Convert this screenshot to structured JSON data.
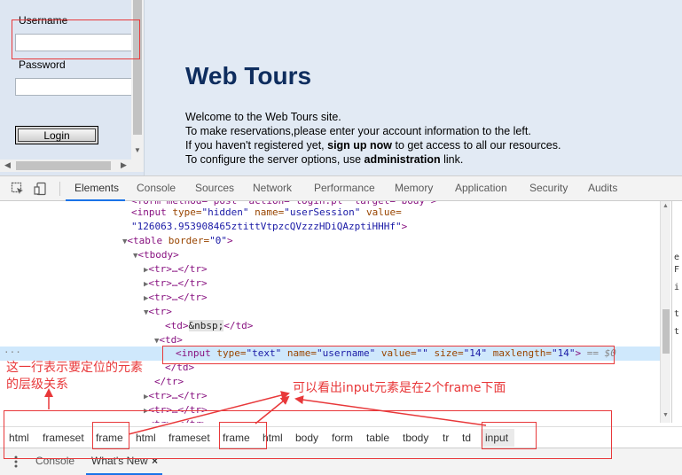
{
  "login": {
    "username_label": "Username",
    "password_label": "Password",
    "username_value": "",
    "password_value": "",
    "login_button": "Login"
  },
  "welcome": {
    "title": "Web Tours",
    "line1": "Welcome to the Web Tours site.",
    "line2": "To make reservations,please enter your account information to the left.",
    "line3_pre": "If you haven't registered yet, ",
    "line3_bold": "sign up now",
    "line3_post": " to get access to all our resources.",
    "line4_pre": "To configure the server options, use ",
    "line4_bold": "administration",
    "line4_post": " link."
  },
  "devtools": {
    "tabs": [
      "Elements",
      "Console",
      "Sources",
      "Network",
      "Performance",
      "Memory",
      "Application",
      "Security",
      "Audits"
    ],
    "active_tab": "Elements",
    "code": {
      "l0": "<form method=\"post\" action=\"login.pl\" target=\"body\">",
      "l1_tag": "<input",
      "l1_a1n": " type=",
      "l1_a1v": "\"hidden\"",
      "l1_a2n": " name=",
      "l1_a2v": "\"userSession\"",
      "l1_a3n": " value=",
      "l2_val": "\"126063.953908465ztittVtpzcQVzzzHDiQAzptiHHHf\"",
      "l2_end": ">",
      "l3_tag": "<table",
      "l3_an": " border=",
      "l3_av": "\"0\"",
      "l3_end": ">",
      "l4": "<tbody>",
      "tr_collapsed": "<tr>…</tr>",
      "tr_open": "<tr>",
      "td_open": "<td>",
      "td_close": "</td>",
      "nbsp": "&nbsp;",
      "sel_tag": "<input",
      "sel_a1n": " type=",
      "sel_a1v": "\"text\"",
      "sel_a2n": " name=",
      "sel_a2v": "\"username\"",
      "sel_a3n": " value=",
      "sel_a3v": "\"\"",
      "sel_a4n": " size=",
      "sel_a4v": "\"14\"",
      "sel_a5n": " maxlength=",
      "sel_a5v": "\"14\"",
      "sel_end": ">",
      "sel_eq": " == $0",
      "tr_close": "</tr>",
      "dots": "..."
    },
    "breadcrumbs": [
      "html",
      "frameset",
      "frame",
      "html",
      "frameset",
      "frame",
      "html",
      "body",
      "form",
      "table",
      "tbody",
      "tr",
      "td",
      "input"
    ],
    "drawer_tabs": [
      "Console",
      "What's New"
    ],
    "drawer_close": "×",
    "side_glyphs": [
      "e",
      "F",
      "i",
      "t",
      "t"
    ]
  },
  "annotations": {
    "note_left_1": "这一行表示要定位的元素",
    "note_left_2": "的层级关系",
    "note_right": "可以看出input元素是在2个frame下面"
  },
  "colors": {
    "annotation_red": "#e8383a",
    "title_navy": "#0e2d5e",
    "page_bg": "#e2eaf4",
    "selection_blue": "#cfe8fc",
    "tag_purple": "#881280",
    "attr_name": "#994500",
    "attr_value": "#1a1aa6",
    "active_tab_blue": "#1a73e8"
  },
  "icons": [
    "inspect-element-icon",
    "device-toggle-icon",
    "drawer-menu-icon",
    "close-icon",
    "expand-arrow-icon",
    "collapse-arrow-icon"
  ]
}
